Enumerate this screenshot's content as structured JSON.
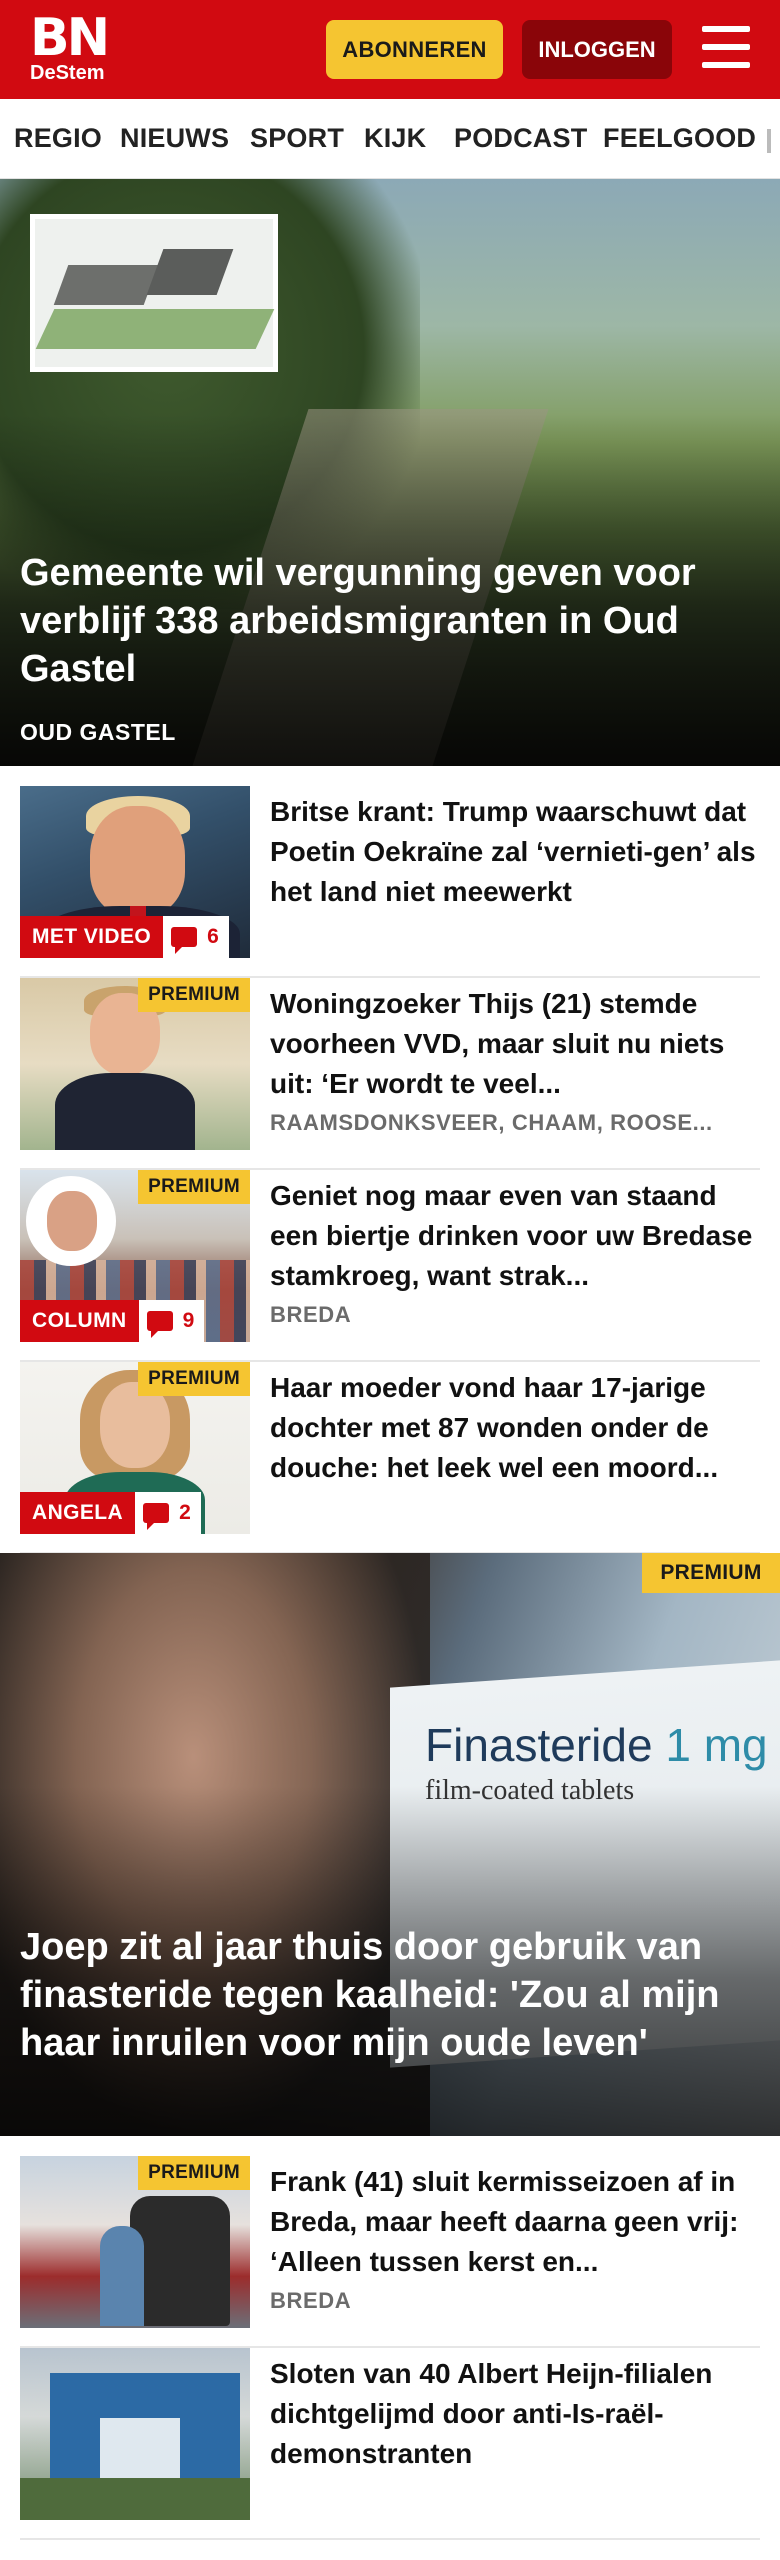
{
  "header": {
    "logo_main": "BN",
    "logo_sub": "DeStem",
    "subscribe_label": "ABONNEREN",
    "login_label": "INLOGGEN"
  },
  "nav": {
    "items": [
      "REGIO",
      "NIEUWS",
      "SPORT",
      "KIJK",
      "PODCAST",
      "FEELGOOD"
    ]
  },
  "hero1": {
    "title": "Gemeente wil vergunning geven voor verblijf 338 arbeidsmigranten in Oud Gastel",
    "location": "OUD GASTEL"
  },
  "articles": [
    {
      "title": "Britse krant: Trump waarschuwt dat Poetin Oekraïne zal ‘vernieti-gen’ als het land niet meewerkt",
      "label": "MET VIDEO",
      "comments": "6"
    },
    {
      "title": "Woningzoeker Thijs (21) stemde voorheen VVD, maar sluit nu niets uit: ‘Er wordt te veel...",
      "premium": "PREMIUM",
      "location": "RAAMSDONKSVEER, CHAAM, ROOSE..."
    },
    {
      "title": "Geniet nog maar even van staand een biertje drinken voor uw Bredase stamkroeg, want strak...",
      "premium": "PREMIUM",
      "label": "COLUMN",
      "comments": "9",
      "location": "BREDA"
    },
    {
      "title": "Haar moeder vond haar 17-jarige dochter met 87 wonden onder de douche: het leek wel een moord...",
      "premium": "PREMIUM",
      "label": "ANGELA",
      "comments": "2"
    }
  ],
  "hero2": {
    "title": "Joep zit al jaar thuis door gebruik van finasteride tegen kaalheid: 'Zou al mijn haar inruilen voor mijn oude leven'",
    "premium": "PREMIUM",
    "box_brand": "Finasteride",
    "box_dose": "1 mg",
    "box_sub": "film-coated tablets"
  },
  "articles2": [
    {
      "title": "Frank (41) sluit kermisseizoen af in Breda, maar heeft daarna geen vrij: ‘Alleen tussen kerst en...",
      "premium": "PREMIUM",
      "location": "BREDA"
    },
    {
      "title": "Sloten van 40 Albert Heijn-filialen dichtgelijmd door anti-Is-raël-demonstranten"
    }
  ],
  "colors": {
    "brand_red": "#d10a11",
    "premium_yellow": "#f5c531",
    "login_dark_red": "#8a0509"
  }
}
